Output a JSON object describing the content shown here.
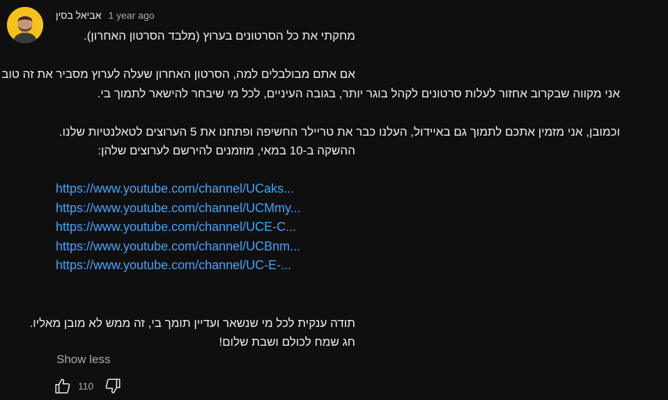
{
  "comment": {
    "author": "אביאל בסין",
    "timestamp": "1 year ago",
    "lines": [
      "מחקתי את כל הסרטונים בערוץ (מלבד הסרטון האחרון).",
      "",
      "אם אתם מבולבלים למה, הסרטון האחרון שעלה לערוץ מסביר את זה טוב :)",
      "אני מקווה שבקרוב אחזור לעלות סרטונים לקהל בוגר יותר, בגובה העיניים, לכל מי שיבחר להישאר לתמוך בי.",
      "",
      "וכמובן, אני מזמין אתכם לתמוך גם באיידול, העלנו כבר את טריילר החשיפה ופתחנו את 5 הערוצים לטאלנטיות שלנו.",
      "ההשקה ב-10 במאי, מוזמנים להירשם לערוצים שלהן:"
    ],
    "links": [
      "https://www.youtube.com/channel/UCaks...",
      "https://www.youtube.com/channel/UCMmy...",
      "https://www.youtube.com/channel/UCE-C...",
      "https://www.youtube.com/channel/UCBnm...",
      "https://www.youtube.com/channel/UC-E-..."
    ],
    "closing": [
      "תודה ענקית לכל מי שנשאר ועדיין תומך בי, זה ממש לא מובן מאליו.",
      "חג שמח לכולם ושבת שלום!"
    ],
    "show_less": "Show less",
    "like_count": "110"
  },
  "colors": {
    "background": "#0f0f0f",
    "text": "#f1f1f1",
    "secondary": "#aaaaaa",
    "link": "#3ea6ff",
    "avatar_bg": "#f4c21a"
  },
  "icons": {
    "like": "thumb-up-icon",
    "dislike": "thumb-down-icon"
  }
}
